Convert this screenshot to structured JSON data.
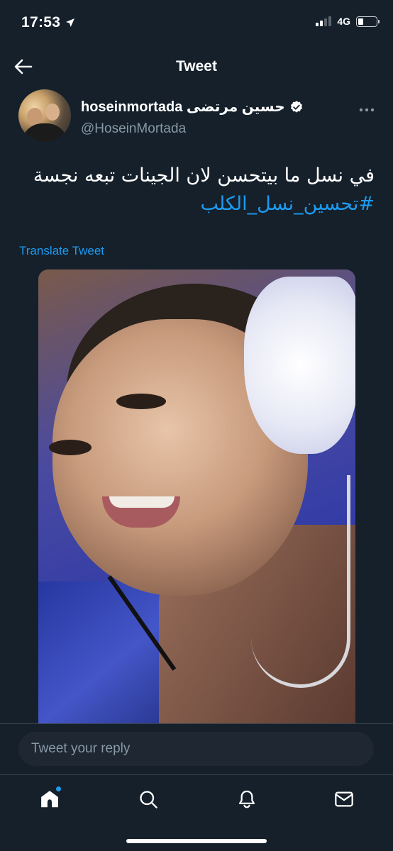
{
  "status_bar": {
    "time": "17:53",
    "network": "4G",
    "location_icon": "location-arrow-icon",
    "signal_icon": "cellular-signal-icon",
    "battery_icon": "battery-low-icon"
  },
  "header": {
    "title": "Tweet",
    "back_icon": "arrow-left-icon"
  },
  "tweet": {
    "author_name": "hoseinmortada حسين مرتضى",
    "author_handle": "@HoseinMortada",
    "verified_icon": "verified-badge-icon",
    "more_icon": "more-horizontal-icon",
    "text_line": "في نسل ما بيتحسن لان الجينات تبعه نجسة",
    "hashtag": "#تحسين_نسل_الكلب",
    "translate_label": "Translate Tweet",
    "image_icon": "tweet-photo"
  },
  "reply": {
    "placeholder": "Tweet your reply",
    "value": ""
  },
  "bottom_nav": {
    "items": [
      {
        "name": "home",
        "icon": "home-icon",
        "has_notification_dot": true
      },
      {
        "name": "search",
        "icon": "search-icon"
      },
      {
        "name": "notifications",
        "icon": "bell-icon"
      },
      {
        "name": "messages",
        "icon": "mail-icon"
      }
    ]
  },
  "colors": {
    "background": "#15202b",
    "accent": "#1d9bf0",
    "secondary_text": "#8899a6",
    "divider": "#38444d"
  }
}
